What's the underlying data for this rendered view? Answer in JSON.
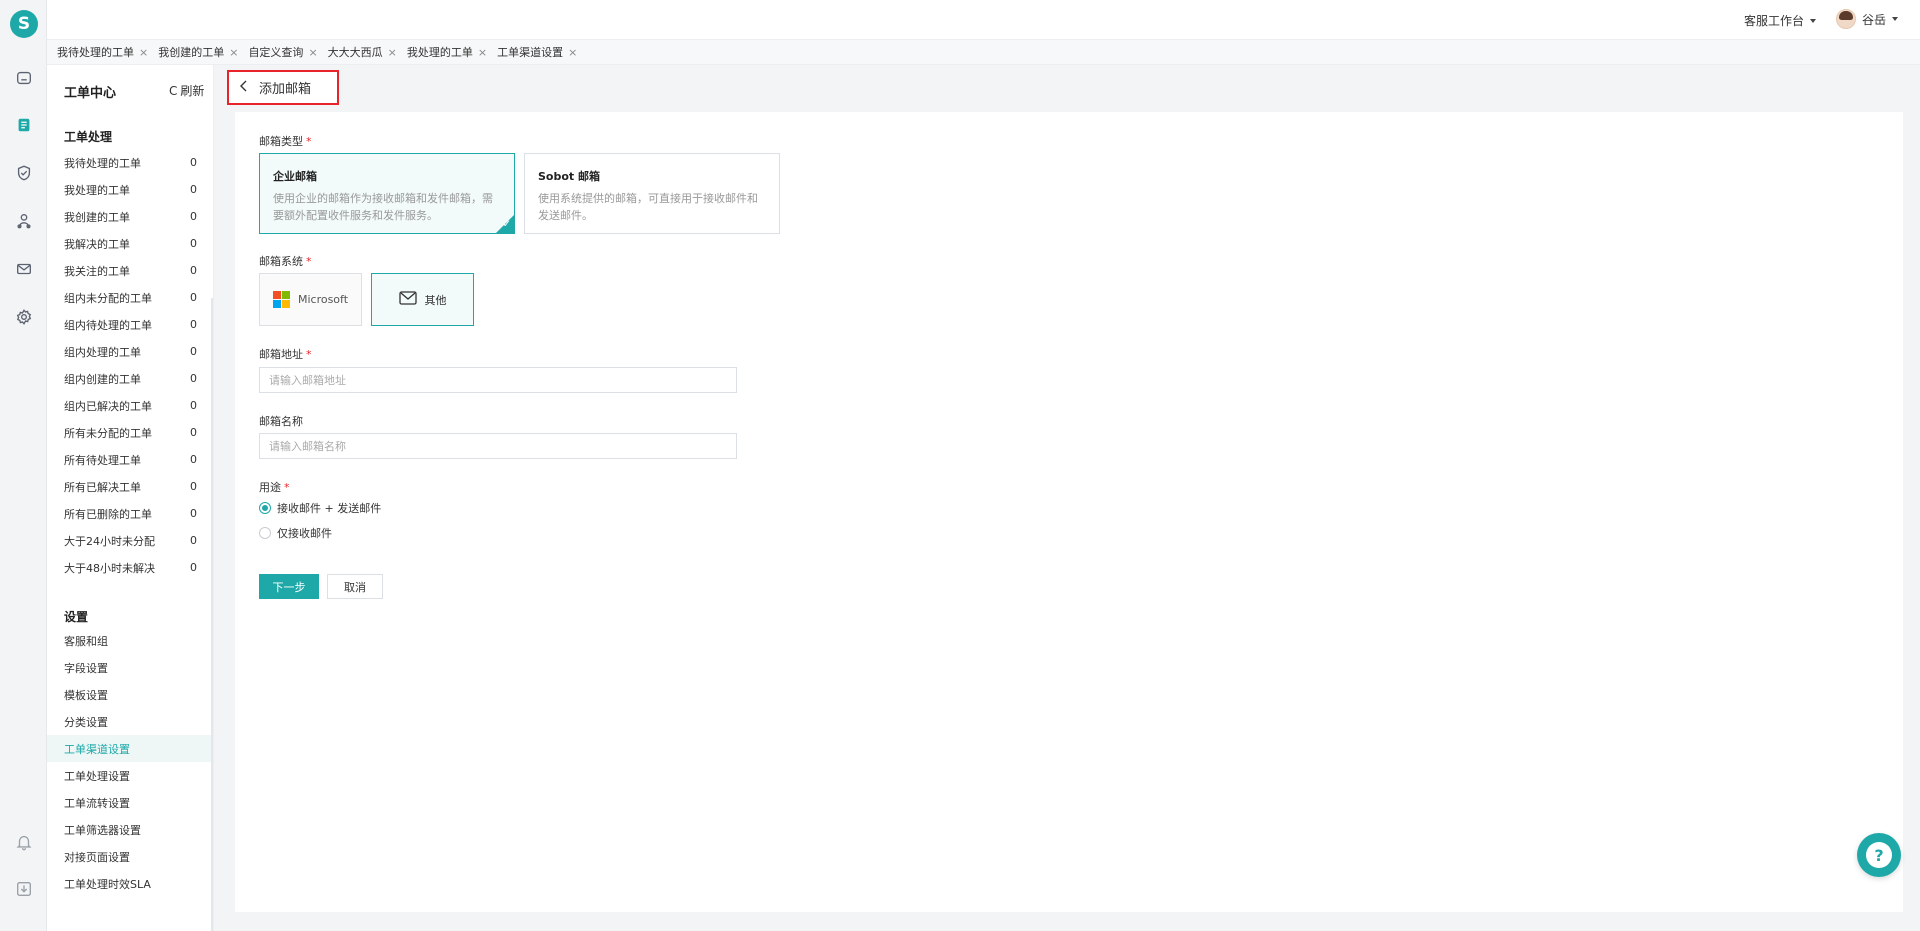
{
  "brand": {
    "logo_letter": "S",
    "accent_color": "#1fa8a8"
  },
  "rail": {
    "icons": [
      "home-icon",
      "ticket-icon",
      "shield-icon",
      "user-network-icon",
      "mail-icon",
      "settings-icon",
      "bell-icon",
      "download-icon"
    ]
  },
  "topbar": {
    "workspace": "客服工作台",
    "user_name": "谷岳"
  },
  "tabs": [
    {
      "label": "我待处理的工单"
    },
    {
      "label": "我创建的工单"
    },
    {
      "label": "自定义查询"
    },
    {
      "label": "大大大西瓜"
    },
    {
      "label": "我处理的工单"
    },
    {
      "label": "工单渠道设置"
    }
  ],
  "sidebar": {
    "title": "工单中心",
    "refresh": "刷新",
    "section_processing": "工单处理",
    "processing_items": [
      {
        "label": "我待处理的工单",
        "count": "0"
      },
      {
        "label": "我处理的工单",
        "count": "0"
      },
      {
        "label": "我创建的工单",
        "count": "0"
      },
      {
        "label": "我解决的工单",
        "count": "0"
      },
      {
        "label": "我关注的工单",
        "count": "0"
      },
      {
        "label": "组内未分配的工单",
        "count": "0"
      },
      {
        "label": "组内待处理的工单",
        "count": "0"
      },
      {
        "label": "组内处理的工单",
        "count": "0"
      },
      {
        "label": "组内创建的工单",
        "count": "0"
      },
      {
        "label": "组内已解决的工单",
        "count": "0"
      },
      {
        "label": "所有未分配的工单",
        "count": "0"
      },
      {
        "label": "所有待处理工单",
        "count": "0"
      },
      {
        "label": "所有已解决工单",
        "count": "0"
      },
      {
        "label": "所有已删除的工单",
        "count": "0"
      },
      {
        "label": "大于24小时未分配",
        "count": "0"
      },
      {
        "label": "大于48小时未解决",
        "count": "0"
      }
    ],
    "section_settings": "设置",
    "settings_items": [
      {
        "label": "客服和组"
      },
      {
        "label": "字段设置"
      },
      {
        "label": "模板设置"
      },
      {
        "label": "分类设置"
      },
      {
        "label": "工单渠道设置"
      },
      {
        "label": "工单处理设置"
      },
      {
        "label": "工单流转设置"
      },
      {
        "label": "工单筛选器设置"
      },
      {
        "label": "对接页面设置"
      },
      {
        "label": "工单处理时效SLA"
      }
    ]
  },
  "page": {
    "title": "添加邮箱",
    "mailbox_type_label": "邮箱类型",
    "type_cards": [
      {
        "title": "企业邮箱",
        "desc": "使用企业的邮箱作为接收邮箱和发件邮箱，需要额外配置收件服务和发件服务。",
        "selected": true
      },
      {
        "title": "Sobot 邮箱",
        "desc": "使用系统提供的邮箱，可直接用于接收邮件和发送邮件。",
        "selected": false
      }
    ],
    "mailbox_system_label": "邮箱系统",
    "systems": [
      {
        "label": "Microsoft",
        "selected": false
      },
      {
        "label": "其他",
        "selected": true
      }
    ],
    "address_label": "邮箱地址",
    "address_placeholder": "请输入邮箱地址",
    "address_value": "",
    "name_label": "邮箱名称",
    "name_placeholder": "请输入邮箱名称",
    "name_value": "",
    "usage_label": "用途",
    "usage_options": [
      {
        "label": "接收邮件 + 发送邮件",
        "checked": true
      },
      {
        "label": "仅接收邮件",
        "checked": false
      }
    ],
    "next_button": "下一步",
    "cancel_button": "取消"
  }
}
